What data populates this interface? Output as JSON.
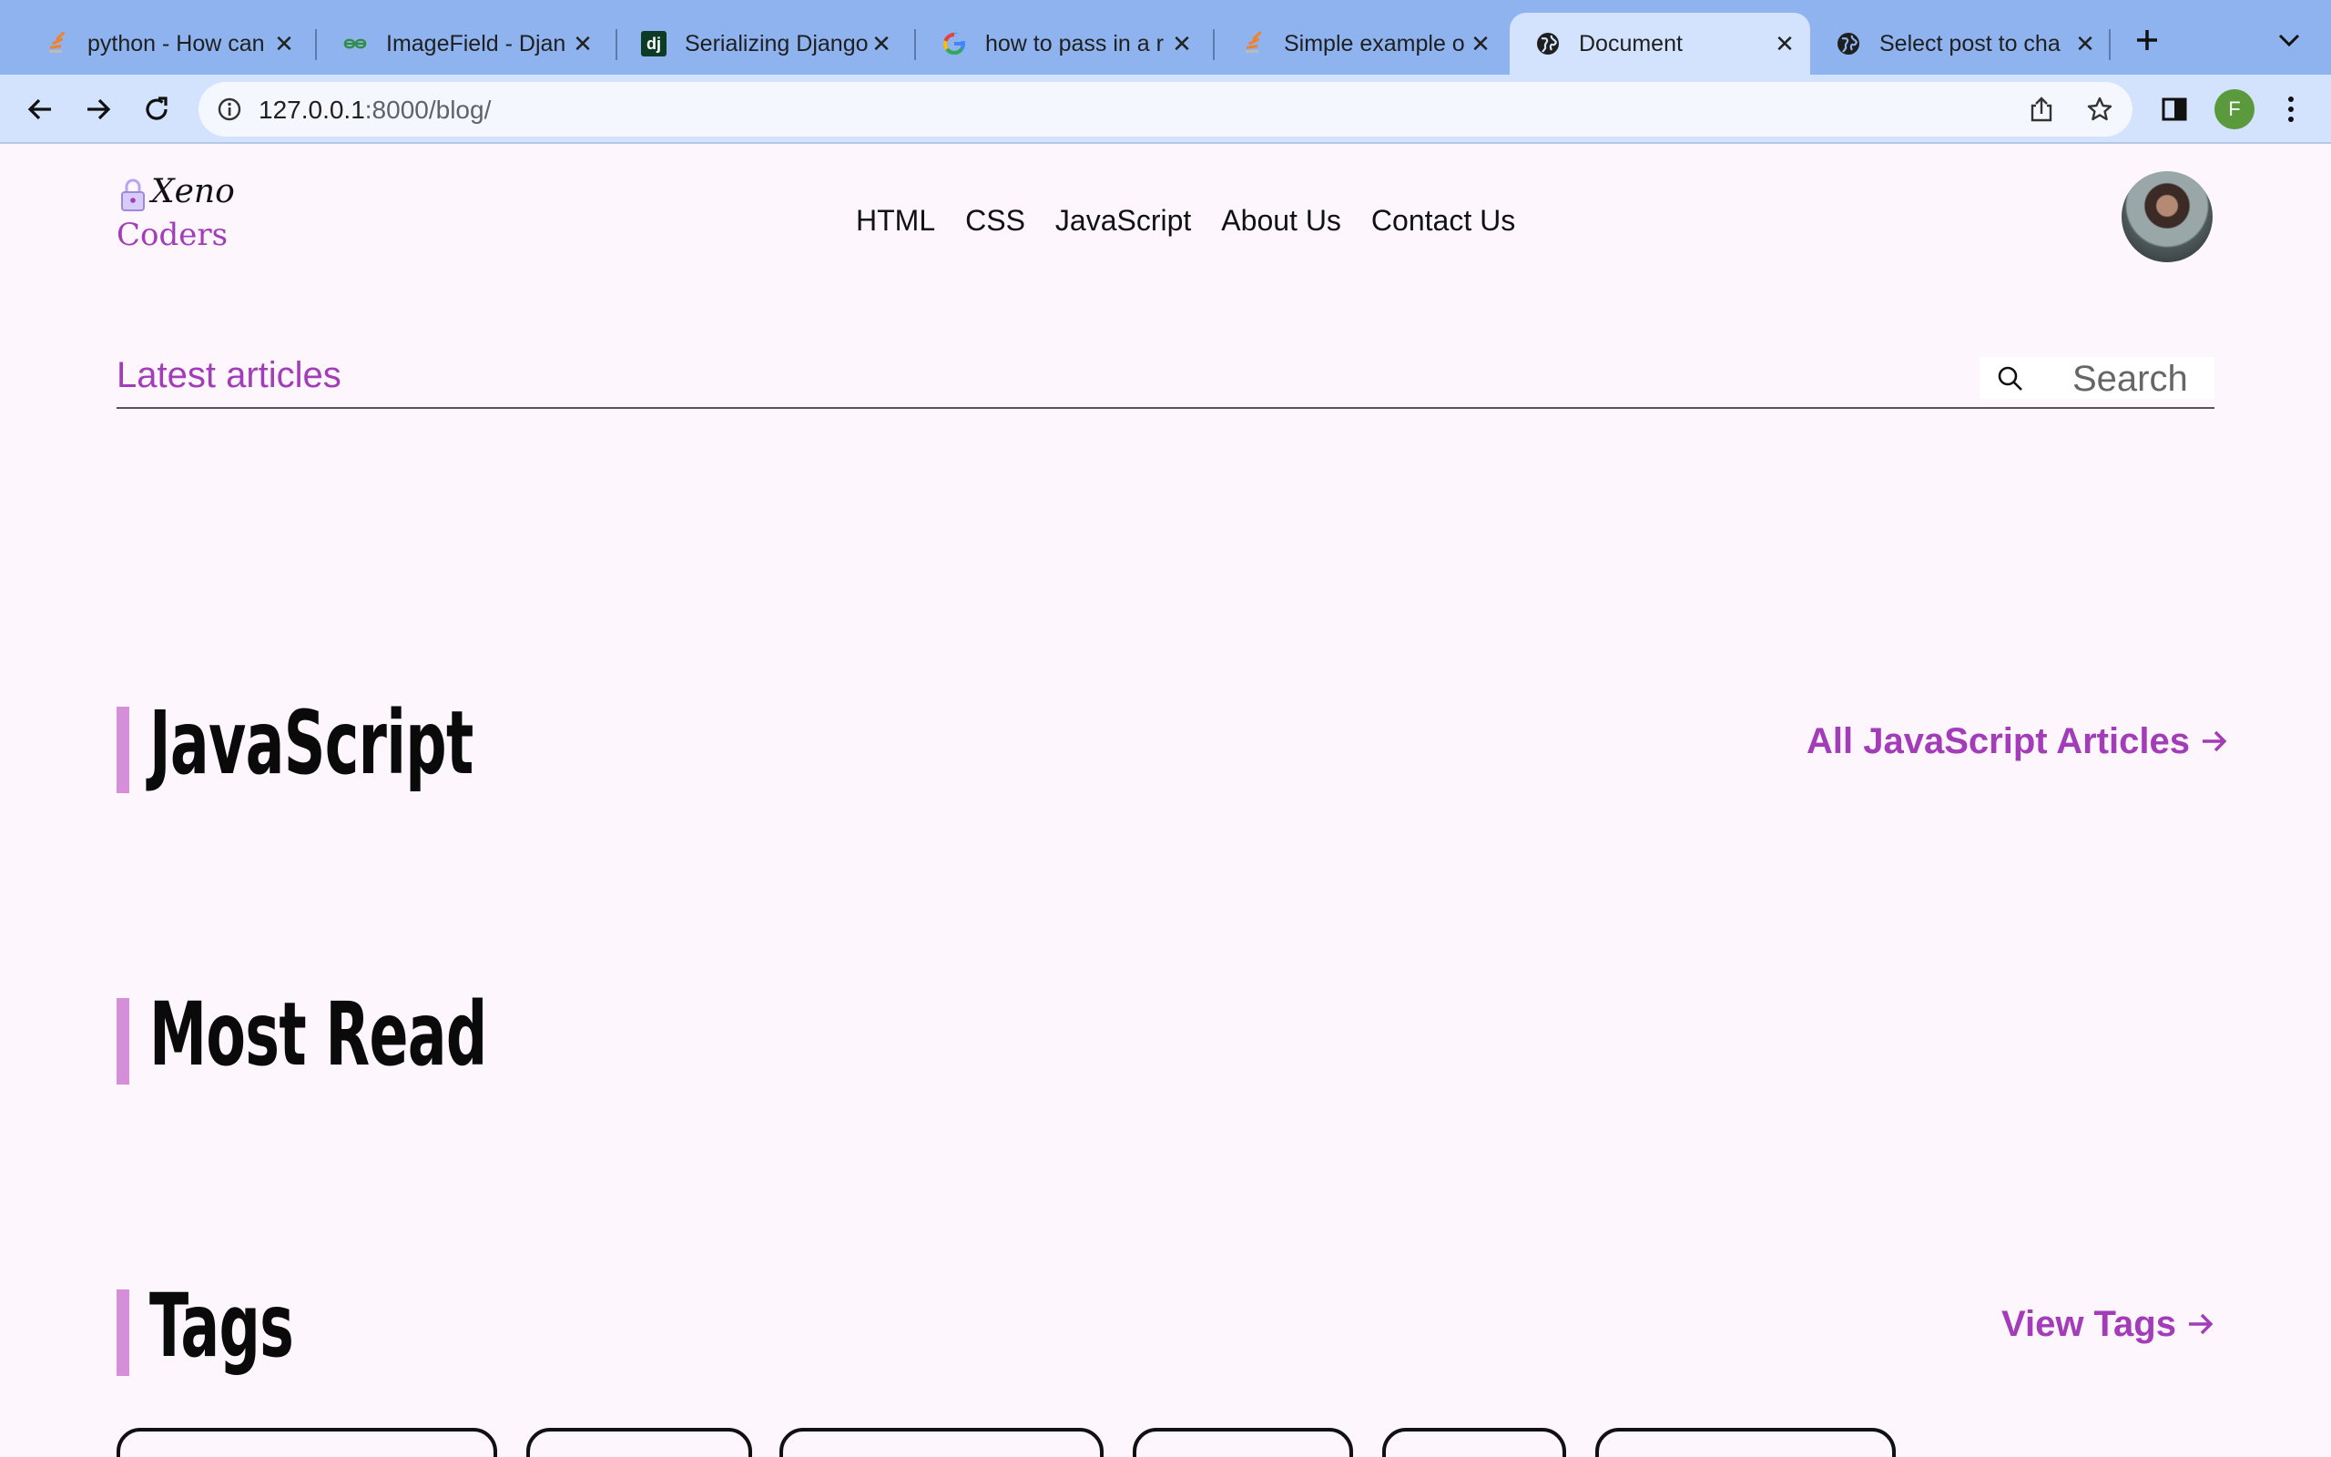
{
  "browser": {
    "tabs": [
      {
        "title": "python - How can",
        "favicon": "stackoverflow-icon"
      },
      {
        "title": "ImageField - Djan",
        "favicon": "geeksforgeeks-icon"
      },
      {
        "title": "Serializing Django",
        "favicon": "django-icon"
      },
      {
        "title": "how to pass in a r",
        "favicon": "google-icon"
      },
      {
        "title": "Simple example o",
        "favicon": "stackoverflow-icon"
      },
      {
        "title": "Document",
        "favicon": "globe-icon",
        "active": true
      },
      {
        "title": "Select post to cha",
        "favicon": "globe-icon"
      }
    ],
    "url_host": "127.0.0.1",
    "url_rest": ":8000/blog/",
    "profile_initial": "F",
    "colors": {
      "tabstrip": "#8eb3ee",
      "toolbar": "#d3e3fd",
      "profile": "#5a9a3d"
    }
  },
  "site": {
    "logo_top": "Xeno",
    "logo_bottom": "Coders",
    "nav": [
      "HTML",
      "CSS",
      "JavaScript",
      "About Us",
      "Contact Us"
    ],
    "latest_label": "Latest articles",
    "search_placeholder": "Search",
    "accent_color": "#a23cb8",
    "bar_color": "#d48fd8"
  },
  "sections": {
    "javascript": {
      "heading": "JavaScript",
      "link": "All JavaScript Articles"
    },
    "most_read": {
      "heading": "Most Read"
    },
    "tags": {
      "heading": "Tags",
      "link": "View Tags"
    }
  }
}
